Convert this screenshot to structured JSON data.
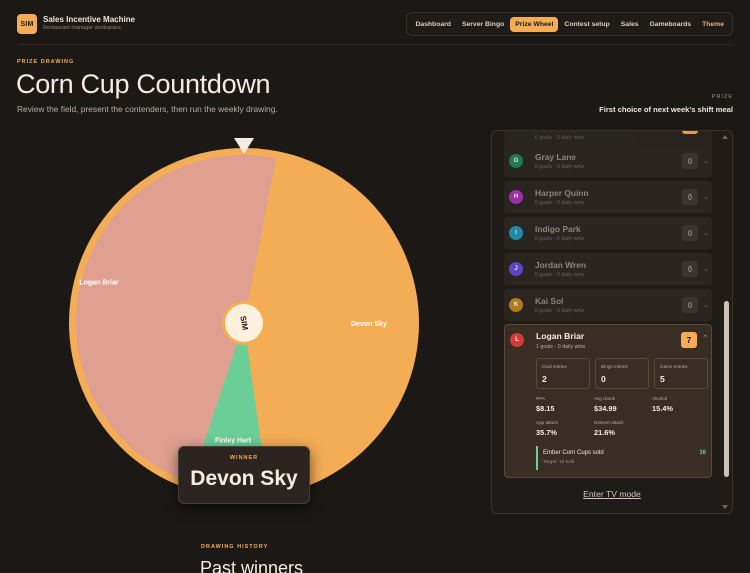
{
  "header": {
    "logo_text": "SIM",
    "app_title": "Sales Incentive Machine",
    "app_subtitle": "Restaurant manager workspace",
    "nav": [
      {
        "label": "Dashboard",
        "active": false
      },
      {
        "label": "Server Bingo",
        "active": false
      },
      {
        "label": "Prize Wheel",
        "active": true
      },
      {
        "label": "Contest setup",
        "active": false
      },
      {
        "label": "Sales",
        "active": false
      },
      {
        "label": "Gameboards",
        "active": false
      }
    ],
    "theme_label": "Theme"
  },
  "hero": {
    "eyebrow": "PRIZE DRAWING",
    "title": "Corn Cup Countdown",
    "description": "Review the field, present the contenders, then run the weekly drawing.",
    "prize_label": "PRIZE",
    "prize_value": "First choice of next week's shift meal"
  },
  "wheel": {
    "center_label": "SIM",
    "colors": {
      "devon": "#f4ad55",
      "finley": "#6cce97",
      "logan": "#e0a091",
      "rim": "#f4ad55",
      "hub": "#fdf1de",
      "hub_ring": "#f4ad55"
    },
    "segments": [
      {
        "name": "Devon Sky",
        "share": 0.447
      },
      {
        "name": "Finley Hart",
        "share": 0.074
      },
      {
        "name": "Logan Briar",
        "share": 0.479
      }
    ],
    "rotation_deg": -79
  },
  "winner": {
    "label": "WINNER",
    "name": "Devon Sky"
  },
  "history": {
    "eyebrow": "DRAWING HISTORY",
    "title": "Past winners"
  },
  "panel": {
    "partial_meta": "0 goals · 0 daily wins",
    "rows": [
      {
        "initial": "G",
        "name": "Gray Lane",
        "meta": "0 goals · 0 daily wins",
        "count": "0",
        "color": "#1f7a52"
      },
      {
        "initial": "H",
        "name": "Harper Quinn",
        "meta": "0 goals · 0 daily wins",
        "count": "0",
        "color": "#9b2fa3"
      },
      {
        "initial": "I",
        "name": "Indigo Park",
        "meta": "0 goals · 0 daily wins",
        "count": "0",
        "color": "#1f8aa8"
      },
      {
        "initial": "J",
        "name": "Jordan Wren",
        "meta": "0 goals · 0 daily wins",
        "count": "0",
        "color": "#5b45c4"
      },
      {
        "initial": "K",
        "name": "Kai Sol",
        "meta": "0 goals · 0 daily wins",
        "count": "0",
        "color": "#b07a1e"
      }
    ],
    "expanded": {
      "initial": "L",
      "name": "Logan Briar",
      "meta": "1 goals · 0 daily wins",
      "count": "7",
      "stats": [
        {
          "label": "Goal entries",
          "value": "2"
        },
        {
          "label": "Bingo entries",
          "value": "0"
        },
        {
          "label": "Game entries",
          "value": "5"
        }
      ],
      "metrics": [
        {
          "label": "PPA",
          "value": "$8.15"
        },
        {
          "label": "Avg check",
          "value": "$34.99"
        },
        {
          "label": "Alcohol",
          "value": "15.4%"
        },
        {
          "label": "App attach",
          "value": "35.7%"
        },
        {
          "label": "Dessert attach",
          "value": "21.6%"
        }
      ],
      "callout": {
        "label": "Ember Corn Cups sold",
        "target": "Target: 12 sold",
        "value": "16"
      }
    },
    "tv_mode": "Enter TV mode"
  }
}
